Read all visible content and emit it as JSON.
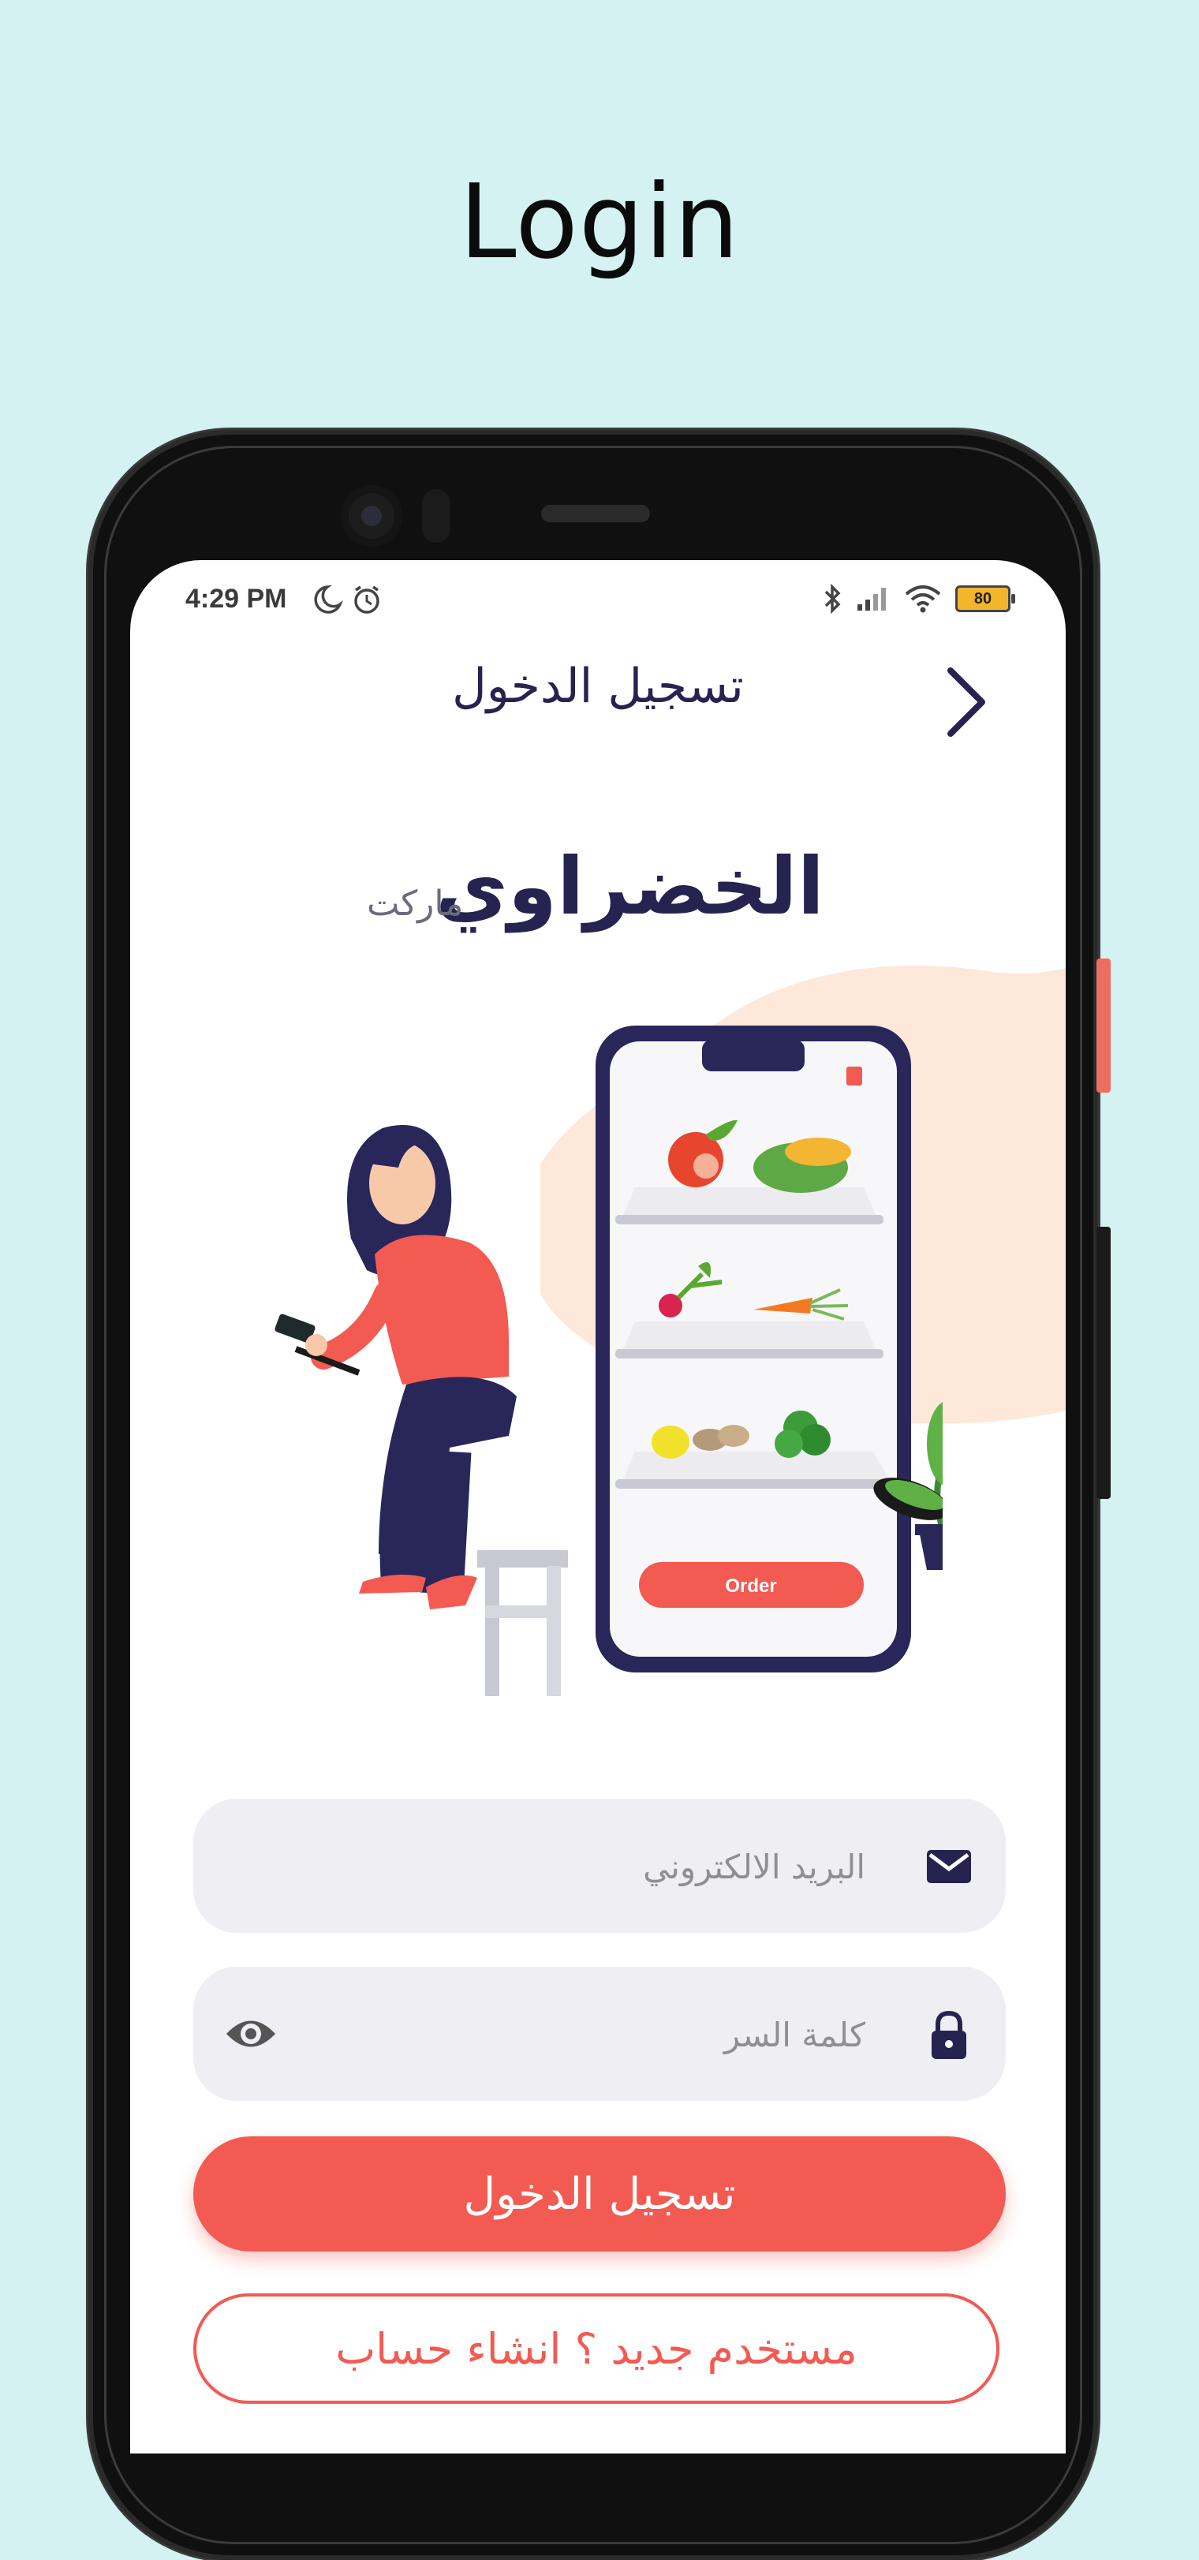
{
  "page": {
    "title": "Login"
  },
  "status_bar": {
    "time": "4:29 PM",
    "battery": "80"
  },
  "header": {
    "title": "تسجيل الدخول"
  },
  "brand": {
    "name": "الخضراوي",
    "suffix": "ماركت"
  },
  "illustration": {
    "order_button": "Order"
  },
  "form": {
    "email_placeholder": "البريد الالكتروني",
    "password_placeholder": "كلمة السر"
  },
  "actions": {
    "login_label": "تسجيل الدخول",
    "signup_label": "مستخدم جديد ؟ انشاء حساب"
  },
  "colors": {
    "accent": "#f25a52",
    "navy": "#262350",
    "background": "#d3f2f1",
    "blob": "#fde8da"
  }
}
